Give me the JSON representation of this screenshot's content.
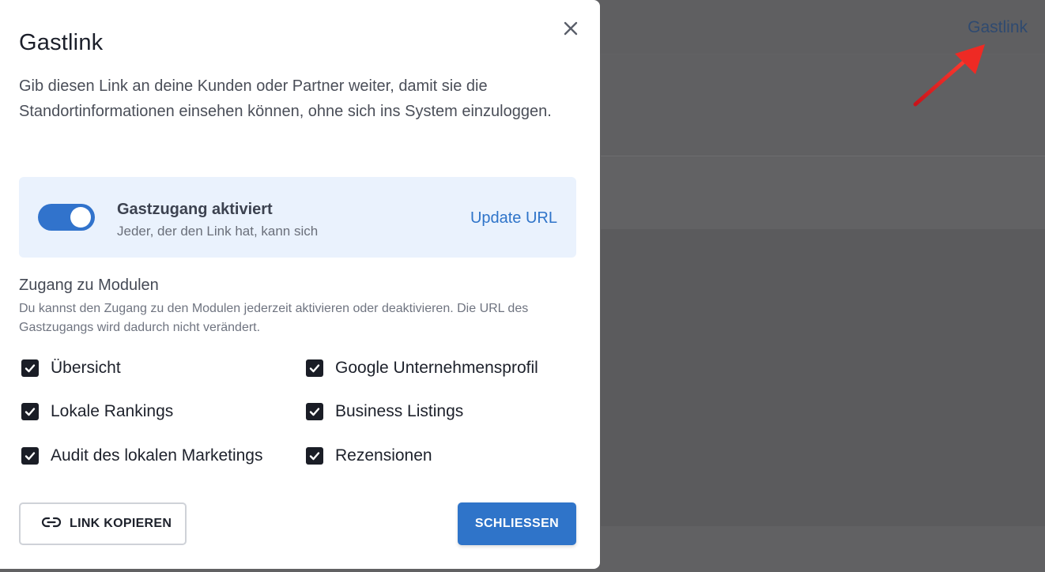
{
  "background": {
    "link": "Gastlink"
  },
  "modal": {
    "title": "Gastlink",
    "intro": "Gib diesen Link an deine Kunden oder Partner weiter, damit sie die Standortinformationen einsehen können, ohne sich ins System einzuloggen.",
    "guest_access": {
      "title": "Gastzugang aktiviert",
      "subtitle": "Jeder, der den Link hat, kann sich",
      "enabled": true,
      "update_url_label": "Update URL"
    },
    "modules": {
      "title": "Zugang zu Modulen",
      "description": "Du kannst den Zugang zu den Modulen jederzeit aktivieren oder deaktivieren. Die URL des Gastzugangs wird dadurch nicht verändert.",
      "items": [
        {
          "label": "Übersicht",
          "checked": true
        },
        {
          "label": "Google Unternehmensprofil",
          "checked": true
        },
        {
          "label": "Lokale Rankings",
          "checked": true
        },
        {
          "label": "Business Listings",
          "checked": true
        },
        {
          "label": "Audit des lokalen Marketings",
          "checked": true
        },
        {
          "label": "Rezensionen",
          "checked": true
        }
      ]
    },
    "buttons": {
      "copy_link": "LINK KOPIEREN",
      "close": "SCHLIESSEN"
    }
  },
  "colors": {
    "accent": "#2f74c9",
    "toggle_card_bg": "#eaf2fd",
    "overlay": "#616163",
    "annotation_arrow": "#e8231f"
  },
  "icons": {
    "close": "close-icon",
    "copy_link": "link-icon",
    "checkbox": "checkmark-icon",
    "annotation": "red-arrow-icon"
  }
}
